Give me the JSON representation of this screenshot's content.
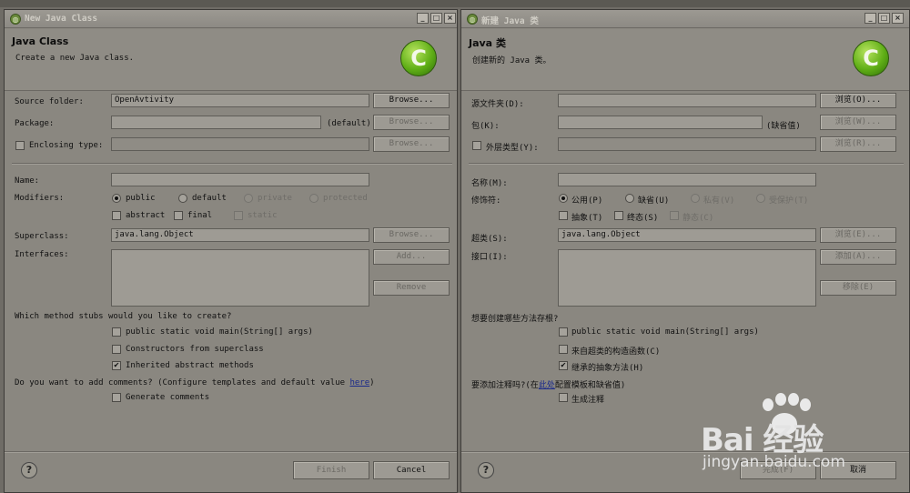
{
  "left": {
    "title": "New Java Class",
    "header_title": "Java Class",
    "header_sub": "Create a new Java class.",
    "source_folder_label": "Source folder:",
    "source_folder_value": "OpenAvtivity",
    "package_label": "Package:",
    "package_default": "(default)",
    "enclosing_label": "Enclosing type:",
    "browse": "Browse...",
    "name_label": "Name:",
    "modifiers_label": "Modifiers:",
    "mod_public": "public",
    "mod_default": "default",
    "mod_private": "private",
    "mod_protected": "protected",
    "mod_abstract": "abstract",
    "mod_final": "final",
    "mod_static": "static",
    "superclass_label": "Superclass:",
    "superclass_value": "java.lang.Object",
    "interfaces_label": "Interfaces:",
    "add": "Add...",
    "remove": "Remove",
    "stubs_question": "Which method stubs would you like to create?",
    "stub_main": "public static void main(String[] args)",
    "stub_constructors": "Constructors from superclass",
    "stub_inherited": "Inherited abstract methods",
    "comments_question": "Do you want to add comments? (Configure templates and default value ",
    "comments_here": "here",
    "comments_end": ")",
    "generate_comments": "Generate comments",
    "finish": "Finish",
    "cancel": "Cancel",
    "help": "?"
  },
  "right": {
    "title": "新建 Java 类",
    "header_title": "Java 类",
    "header_sub": "创建新的 Java 类。",
    "source_folder_label": "源文件夹(D):",
    "package_label": "包(K):",
    "package_default": "(缺省值)",
    "enclosing_label": "外层类型(Y):",
    "browse": "浏览(O)...",
    "browse_w": "浏览(W)...",
    "browse_r": "浏览(R)...",
    "name_label": "名称(M):",
    "modifiers_label": "修饰符:",
    "mod_public": "公用(P)",
    "mod_default": "缺省(U)",
    "mod_private": "私有(V)",
    "mod_protected": "受保护(T)",
    "mod_abstract": "抽象(T)",
    "mod_final": "终态(S)",
    "mod_static": "静态(C)",
    "superclass_label": "超类(S):",
    "superclass_value": "java.lang.Object",
    "browse_e": "浏览(E)...",
    "interfaces_label": "接口(I):",
    "add": "添加(A)...",
    "remove": "移除(E)",
    "stubs_question": "想要创建哪些方法存根?",
    "stub_main": "public static void main(String[] args)",
    "stub_constructors": "来自超类的构造函数(C)",
    "stub_inherited": "继承的抽象方法(H)",
    "comments_question": "要添加注释吗?(在",
    "comments_here": "此处",
    "comments_end": "配置模板和缺省值)",
    "generate_comments": "生成注释",
    "finish": "完成(F)",
    "cancel": "取消",
    "help": "?"
  },
  "watermark": {
    "brand": "Bai  经验",
    "url": "jingyan.baidu.com"
  },
  "checked_mark": "✔",
  "colors": {
    "logo": "#5fae16",
    "link": "#1a2a8a"
  }
}
